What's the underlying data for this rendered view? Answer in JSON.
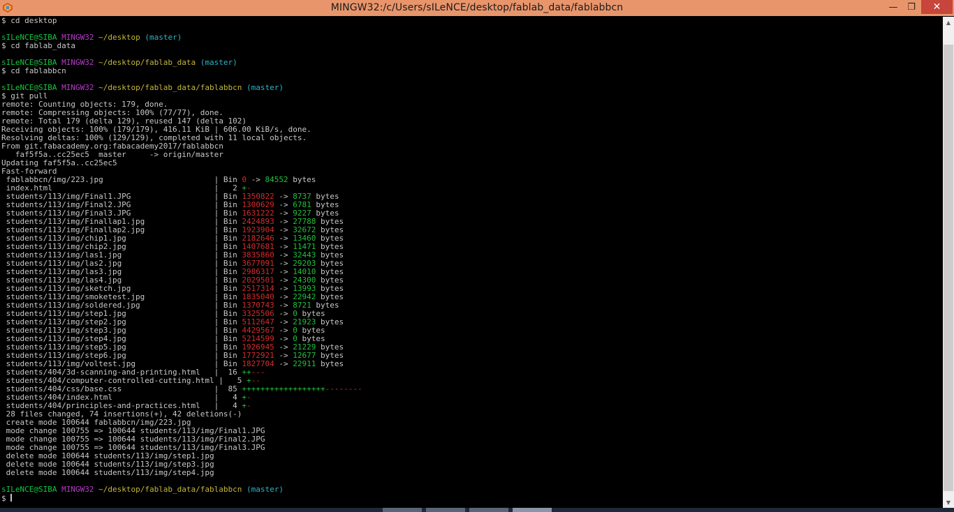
{
  "window": {
    "title": "MINGW32:/c/Users/sILeNCE/desktop/fablab_data/fablabbcn",
    "min_glyph": "—",
    "max_glyph": "❐",
    "close_glyph": "✕",
    "scroll_up_glyph": "▲",
    "scroll_down_glyph": "▼",
    "colors": {
      "titlebar": "#e9956b",
      "close": "#c7453a",
      "background": "#000000",
      "user": "#13c840",
      "host": "#b93bcc",
      "path": "#c4b73c",
      "branch": "#2bb6c7",
      "deletions": "#d42c2c",
      "insertions": "#1fc43a"
    }
  },
  "terminal": {
    "lines": [
      [
        {
          "t": "$ cd desktop"
        }
      ],
      [
        {
          "t": ""
        }
      ],
      [
        {
          "t": "sILeNCE@SIBA",
          "c": "user"
        },
        {
          "t": " "
        },
        {
          "t": "MINGW32",
          "c": "host"
        },
        {
          "t": " "
        },
        {
          "t": "~/desktop",
          "c": "path"
        },
        {
          "t": " "
        },
        {
          "t": "(master)",
          "c": "branch"
        }
      ],
      [
        {
          "t": "$ cd fablab_data"
        }
      ],
      [
        {
          "t": ""
        }
      ],
      [
        {
          "t": "sILeNCE@SIBA",
          "c": "user"
        },
        {
          "t": " "
        },
        {
          "t": "MINGW32",
          "c": "host"
        },
        {
          "t": " "
        },
        {
          "t": "~/desktop/fablab_data",
          "c": "path"
        },
        {
          "t": " "
        },
        {
          "t": "(master)",
          "c": "branch"
        }
      ],
      [
        {
          "t": "$ cd fablabbcn"
        }
      ],
      [
        {
          "t": ""
        }
      ],
      [
        {
          "t": "sILeNCE@SIBA",
          "c": "user"
        },
        {
          "t": " "
        },
        {
          "t": "MINGW32",
          "c": "host"
        },
        {
          "t": " "
        },
        {
          "t": "~/desktop/fablab_data/fablabbcn",
          "c": "path"
        },
        {
          "t": " "
        },
        {
          "t": "(master)",
          "c": "branch"
        }
      ],
      [
        {
          "t": "$ git pull"
        }
      ],
      [
        {
          "t": "remote: Counting objects: 179, done."
        }
      ],
      [
        {
          "t": "remote: Compressing objects: 100% (77/77), done."
        }
      ],
      [
        {
          "t": "remote: Total 179 (delta 129), reused 147 (delta 102)"
        }
      ],
      [
        {
          "t": "Receiving objects: 100% (179/179), 416.11 KiB | 606.00 KiB/s, done."
        }
      ],
      [
        {
          "t": "Resolving deltas: 100% (129/129), completed with 11 local objects."
        }
      ],
      [
        {
          "t": "From git.fabacademy.org:fabacademy2017/fablabbcn"
        }
      ],
      [
        {
          "t": "   faf5f5a..cc25ec5  master     -> origin/master"
        }
      ],
      [
        {
          "t": "Updating faf5f5a..cc25ec5"
        }
      ],
      [
        {
          "t": "Fast-forward"
        }
      ],
      [
        {
          "t": " fablabbcn/img/223.jpg                        | Bin "
        },
        {
          "t": "0",
          "c": "red"
        },
        {
          "t": " -> "
        },
        {
          "t": "84552",
          "c": "green"
        },
        {
          "t": " bytes"
        }
      ],
      [
        {
          "t": " index.html                                   |   2 "
        },
        {
          "t": "+",
          "c": "green"
        },
        {
          "t": "-",
          "c": "red"
        }
      ],
      [
        {
          "t": " students/113/img/Final1.JPG                  | Bin "
        },
        {
          "t": "1350822",
          "c": "red"
        },
        {
          "t": " -> "
        },
        {
          "t": "8737",
          "c": "green"
        },
        {
          "t": " bytes"
        }
      ],
      [
        {
          "t": " students/113/img/Final2.JPG                  | Bin "
        },
        {
          "t": "1300629",
          "c": "red"
        },
        {
          "t": " -> "
        },
        {
          "t": "6781",
          "c": "green"
        },
        {
          "t": " bytes"
        }
      ],
      [
        {
          "t": " students/113/img/Final3.JPG                  | Bin "
        },
        {
          "t": "1631222",
          "c": "red"
        },
        {
          "t": " -> "
        },
        {
          "t": "9227",
          "c": "green"
        },
        {
          "t": " bytes"
        }
      ],
      [
        {
          "t": " students/113/img/Finallap1.jpg               | Bin "
        },
        {
          "t": "2424893",
          "c": "red"
        },
        {
          "t": " -> "
        },
        {
          "t": "27788",
          "c": "green"
        },
        {
          "t": " bytes"
        }
      ],
      [
        {
          "t": " students/113/img/Finallap2.jpg               | Bin "
        },
        {
          "t": "1923904",
          "c": "red"
        },
        {
          "t": " -> "
        },
        {
          "t": "32672",
          "c": "green"
        },
        {
          "t": " bytes"
        }
      ],
      [
        {
          "t": " students/113/img/chip1.jpg                   | Bin "
        },
        {
          "t": "2182646",
          "c": "red"
        },
        {
          "t": " -> "
        },
        {
          "t": "13460",
          "c": "green"
        },
        {
          "t": " bytes"
        }
      ],
      [
        {
          "t": " students/113/img/chip2.jpg                   | Bin "
        },
        {
          "t": "1407681",
          "c": "red"
        },
        {
          "t": " -> "
        },
        {
          "t": "11471",
          "c": "green"
        },
        {
          "t": " bytes"
        }
      ],
      [
        {
          "t": " students/113/img/las1.jpg                    | Bin "
        },
        {
          "t": "3835860",
          "c": "red"
        },
        {
          "t": " -> "
        },
        {
          "t": "32443",
          "c": "green"
        },
        {
          "t": " bytes"
        }
      ],
      [
        {
          "t": " students/113/img/las2.jpg                    | Bin "
        },
        {
          "t": "3677091",
          "c": "red"
        },
        {
          "t": " -> "
        },
        {
          "t": "29203",
          "c": "green"
        },
        {
          "t": " bytes"
        }
      ],
      [
        {
          "t": " students/113/img/las3.jpg                    | Bin "
        },
        {
          "t": "2986317",
          "c": "red"
        },
        {
          "t": " -> "
        },
        {
          "t": "14010",
          "c": "green"
        },
        {
          "t": " bytes"
        }
      ],
      [
        {
          "t": " students/113/img/las4.jpg                    | Bin "
        },
        {
          "t": "2029501",
          "c": "red"
        },
        {
          "t": " -> "
        },
        {
          "t": "24300",
          "c": "green"
        },
        {
          "t": " bytes"
        }
      ],
      [
        {
          "t": " students/113/img/sketch.jpg                  | Bin "
        },
        {
          "t": "2517314",
          "c": "red"
        },
        {
          "t": " -> "
        },
        {
          "t": "13993",
          "c": "green"
        },
        {
          "t": " bytes"
        }
      ],
      [
        {
          "t": " students/113/img/smoketest.jpg               | Bin "
        },
        {
          "t": "1835040",
          "c": "red"
        },
        {
          "t": " -> "
        },
        {
          "t": "22942",
          "c": "green"
        },
        {
          "t": " bytes"
        }
      ],
      [
        {
          "t": " students/113/img/soldered.jpg                | Bin "
        },
        {
          "t": "1370743",
          "c": "red"
        },
        {
          "t": " -> "
        },
        {
          "t": "8721",
          "c": "green"
        },
        {
          "t": " bytes"
        }
      ],
      [
        {
          "t": " students/113/img/step1.jpg                   | Bin "
        },
        {
          "t": "3325506",
          "c": "red"
        },
        {
          "t": " -> "
        },
        {
          "t": "0",
          "c": "green"
        },
        {
          "t": " bytes"
        }
      ],
      [
        {
          "t": " students/113/img/step2.jpg                   | Bin "
        },
        {
          "t": "5112647",
          "c": "red"
        },
        {
          "t": " -> "
        },
        {
          "t": "21923",
          "c": "green"
        },
        {
          "t": " bytes"
        }
      ],
      [
        {
          "t": " students/113/img/step3.jpg                   | Bin "
        },
        {
          "t": "4429567",
          "c": "red"
        },
        {
          "t": " -> "
        },
        {
          "t": "0",
          "c": "green"
        },
        {
          "t": " bytes"
        }
      ],
      [
        {
          "t": " students/113/img/step4.jpg                   | Bin "
        },
        {
          "t": "5214599",
          "c": "red"
        },
        {
          "t": " -> "
        },
        {
          "t": "0",
          "c": "green"
        },
        {
          "t": " bytes"
        }
      ],
      [
        {
          "t": " students/113/img/step5.jpg                   | Bin "
        },
        {
          "t": "1926945",
          "c": "red"
        },
        {
          "t": " -> "
        },
        {
          "t": "21229",
          "c": "green"
        },
        {
          "t": " bytes"
        }
      ],
      [
        {
          "t": " students/113/img/step6.jpg                   | Bin "
        },
        {
          "t": "1772921",
          "c": "red"
        },
        {
          "t": " -> "
        },
        {
          "t": "12677",
          "c": "green"
        },
        {
          "t": " bytes"
        }
      ],
      [
        {
          "t": " students/113/img/voltest.jpg                 | Bin "
        },
        {
          "t": "1827704",
          "c": "red"
        },
        {
          "t": " -> "
        },
        {
          "t": "22911",
          "c": "green"
        },
        {
          "t": " bytes"
        }
      ],
      [
        {
          "t": " students/404/3d-scanning-and-printing.html   |  16 "
        },
        {
          "t": "++",
          "c": "green"
        },
        {
          "t": "---",
          "c": "red"
        }
      ],
      [
        {
          "t": " students/404/computer-controlled-cutting.html |   5 "
        },
        {
          "t": "+",
          "c": "green"
        },
        {
          "t": "--",
          "c": "red"
        }
      ],
      [
        {
          "t": " students/404/css/base.css                    |  85 "
        },
        {
          "t": "++++++++++++++++++",
          "c": "green"
        },
        {
          "t": "--------",
          "c": "red"
        }
      ],
      [
        {
          "t": " students/404/index.html                      |   4 "
        },
        {
          "t": "+",
          "c": "green"
        },
        {
          "t": "-",
          "c": "red"
        }
      ],
      [
        {
          "t": " students/404/principles-and-practices.html   |   4 "
        },
        {
          "t": "+",
          "c": "green"
        },
        {
          "t": "-",
          "c": "red"
        }
      ],
      [
        {
          "t": " 28 files changed, 74 insertions(+), 42 deletions(-)"
        }
      ],
      [
        {
          "t": " create mode 100644 fablabbcn/img/223.jpg"
        }
      ],
      [
        {
          "t": " mode change 100755 => 100644 students/113/img/Final1.JPG"
        }
      ],
      [
        {
          "t": " mode change 100755 => 100644 students/113/img/Final2.JPG"
        }
      ],
      [
        {
          "t": " mode change 100755 => 100644 students/113/img/Final3.JPG"
        }
      ],
      [
        {
          "t": " delete mode 100644 students/113/img/step1.jpg"
        }
      ],
      [
        {
          "t": " delete mode 100644 students/113/img/step3.jpg"
        }
      ],
      [
        {
          "t": " delete mode 100644 students/113/img/step4.jpg"
        }
      ],
      [
        {
          "t": ""
        }
      ],
      [
        {
          "t": "sILeNCE@SIBA",
          "c": "user"
        },
        {
          "t": " "
        },
        {
          "t": "MINGW32",
          "c": "host"
        },
        {
          "t": " "
        },
        {
          "t": "~/desktop/fablab_data/fablabbcn",
          "c": "path"
        },
        {
          "t": " "
        },
        {
          "t": "(master)",
          "c": "branch"
        }
      ],
      [
        {
          "t": "$ "
        },
        {
          "cursor": true
        }
      ]
    ]
  }
}
